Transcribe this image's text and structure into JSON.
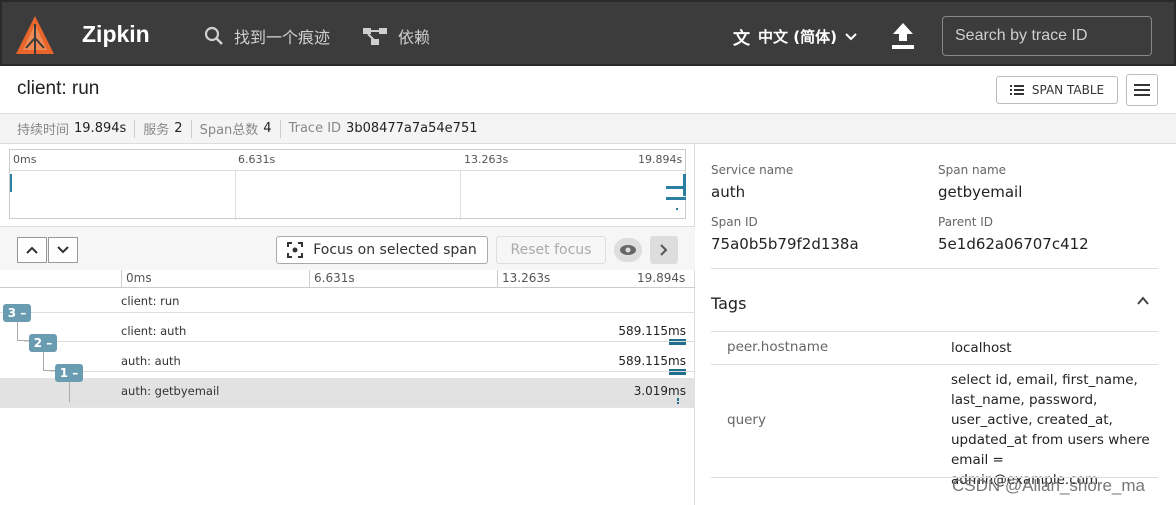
{
  "header": {
    "brand": "Zipkin",
    "nav_find": "找到一个痕迹",
    "nav_deps": "依赖",
    "language": "中文 (简体)",
    "search_placeholder": "Search by trace ID"
  },
  "trace": {
    "title": "client: run",
    "span_table_label": "SPAN TABLE",
    "stats": {
      "duration_label": "持续时间",
      "duration": "19.894s",
      "services_label": "服务",
      "services": "2",
      "spans_label": "Span总数",
      "spans": "4",
      "traceid_label": "Trace ID",
      "traceid": "3b08477a7a54e751"
    }
  },
  "minimap": {
    "ticks": [
      "0ms",
      "6.631s",
      "13.263s",
      "19.894s"
    ]
  },
  "toolbar": {
    "focus_label": "Focus on selected span",
    "reset_label": "Reset focus"
  },
  "timeline": {
    "ticks": [
      "0ms",
      "6.631s",
      "13.263s",
      "19.894s"
    ],
    "rows": [
      {
        "label": "client: run",
        "duration": "",
        "badge": "3 –"
      },
      {
        "label": "client: auth",
        "duration": "589.115ms",
        "badge": "2 –"
      },
      {
        "label": "auth: auth",
        "duration": "589.115ms",
        "badge": "1 –"
      },
      {
        "label": "auth: getbyemail",
        "duration": "3.019ms",
        "badge": ""
      }
    ]
  },
  "detail": {
    "service_name_label": "Service name",
    "service_name": "auth",
    "span_name_label": "Span name",
    "span_name": "getbyemail",
    "span_id_label": "Span ID",
    "span_id": "75a0b5b79f2d138a",
    "parent_id_label": "Parent ID",
    "parent_id": "5e1d62a06707c412",
    "tags_title": "Tags",
    "tags": [
      {
        "key": "peer.hostname",
        "value": "localhost"
      },
      {
        "key": "query",
        "value_lines": [
          "select id, email, first_name,",
          "last_name, password,",
          "user_active, created_at,",
          "updated_at from users where",
          "email = admin@example.com"
        ]
      }
    ]
  },
  "watermark": "CSDN @Allan_shore_ma",
  "colors": {
    "topbar": "#3c3c3c",
    "accent": "#e8662c",
    "bar": "#1f6f8f",
    "badge": "#6a9cb1"
  }
}
